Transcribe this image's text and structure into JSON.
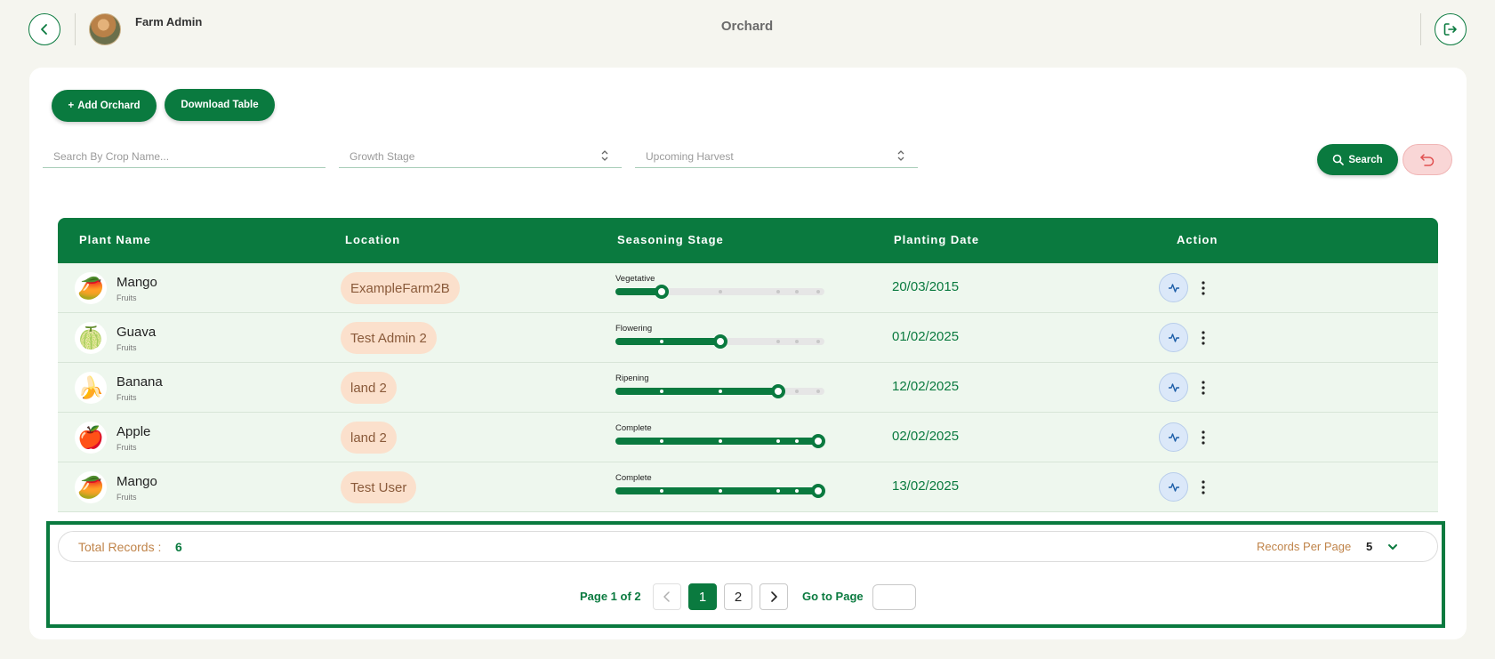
{
  "header": {
    "user_name": "Farm Admin",
    "page_title": "Orchard"
  },
  "toolbar": {
    "add_label": "Add Orchard",
    "download_label": "Download Table"
  },
  "filters": {
    "search_placeholder": "Search By Crop Name...",
    "growth_stage_placeholder": "Growth Stage",
    "harvest_placeholder": "Upcoming Harvest",
    "search_button": "Search"
  },
  "table": {
    "columns": [
      "Plant Name",
      "Location",
      "Seasoning Stage",
      "Planting Date",
      "Action"
    ],
    "rows": [
      {
        "name": "Mango",
        "category": "Fruits",
        "icon": "🥭",
        "location": "ExampleFarm2B",
        "stage": "Vegetative",
        "progress": 0.22,
        "date": "20/03/2015"
      },
      {
        "name": "Guava",
        "category": "Fruits",
        "icon": "🍈",
        "location": "Test Admin 2",
        "stage": "Flowering",
        "progress": 0.5,
        "date": "01/02/2025"
      },
      {
        "name": "Banana",
        "category": "Fruits",
        "icon": "🍌",
        "location": "land 2",
        "stage": "Ripening",
        "progress": 0.78,
        "date": "12/02/2025"
      },
      {
        "name": "Apple",
        "category": "Fruits",
        "icon": "🍎",
        "location": "land 2",
        "stage": "Complete",
        "progress": 0.97,
        "date": "02/02/2025"
      },
      {
        "name": "Mango",
        "category": "Fruits",
        "icon": "🥭",
        "location": "Test User",
        "stage": "Complete",
        "progress": 0.97,
        "date": "13/02/2025"
      }
    ]
  },
  "footer": {
    "total_label": "Total Records :",
    "total_value": "6",
    "per_page_label": "Records Per Page",
    "per_page_value": "5"
  },
  "pagination": {
    "page_text": "Page 1 of 2",
    "pages": [
      "1",
      "2"
    ],
    "goto_label": "Go to Page",
    "goto_value": ""
  },
  "colors": {
    "primary": "#0a7a3f",
    "row_bg": "#eef7ee",
    "location_chip": "#fbe0cc",
    "reset_bg": "#f9d6d6"
  }
}
